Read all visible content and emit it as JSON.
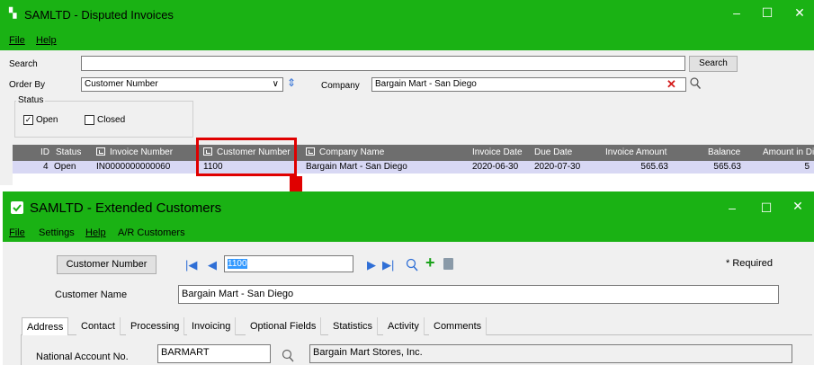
{
  "invoices_window": {
    "title": "SAMLTD - Disputed Invoices",
    "menu": [
      "File",
      "Help"
    ],
    "window_controls": {
      "minimize": "–",
      "maximize": "☐",
      "close": "✕"
    },
    "search": {
      "label": "Search",
      "value": "",
      "button": "Search"
    },
    "order_by": {
      "label": "Order By",
      "value": "Customer Number",
      "arrow": "∨",
      "sort": "⇕"
    },
    "company": {
      "label": "Company",
      "value": "Bargain Mart - San Diego",
      "clear": "✕"
    },
    "status": {
      "label": "Status",
      "open_label": "Open",
      "open_checked": true,
      "closed_label": "Closed",
      "closed_checked": false
    },
    "table": {
      "columns": [
        "ID",
        "Status",
        "Invoice Number",
        "Customer Number",
        "Company Name",
        "Invoice Date",
        "Due Date",
        "Invoice Amount",
        "Balance",
        "Amount in Di"
      ],
      "rows": [
        {
          "id": "4",
          "status": "Open",
          "invoice_number": "IN0000000000060",
          "customer_number": "1100",
          "company_name": "Bargain Mart - San Diego",
          "invoice_date": "2020-06-30",
          "due_date": "2020-07-30",
          "invoice_amount": "565.63",
          "balance": "565.63",
          "amount_in_dispute": "5"
        }
      ]
    }
  },
  "customers_window": {
    "title": "SAMLTD - Extended Customers",
    "menu": [
      "File",
      "Settings",
      "Help",
      "A/R Customers"
    ],
    "window_controls": {
      "minimize": "–",
      "maximize": "☐",
      "close": "✕"
    },
    "customer_number_button": "Customer Number",
    "customer_number_value": "1100",
    "required_note": "* Required",
    "customer_name_label": "Customer Name",
    "customer_name_value": "Bargain Mart - San Diego",
    "tabs": [
      "Address",
      "Contact",
      "Processing",
      "Invoicing",
      "Optional Fields",
      "Statistics",
      "Activity",
      "Comments"
    ],
    "active_tab": "Address",
    "national_account": {
      "label": "National Account No.",
      "value": "BARMART",
      "description": "Bargain Mart Stores, Inc."
    }
  },
  "colors": {
    "title_bar": "#1ab214",
    "grid_header": "#6e6e6e",
    "selected_row": "#d8d8f4",
    "highlight": "#e00000",
    "nav_icon": "#2f6fd6"
  }
}
